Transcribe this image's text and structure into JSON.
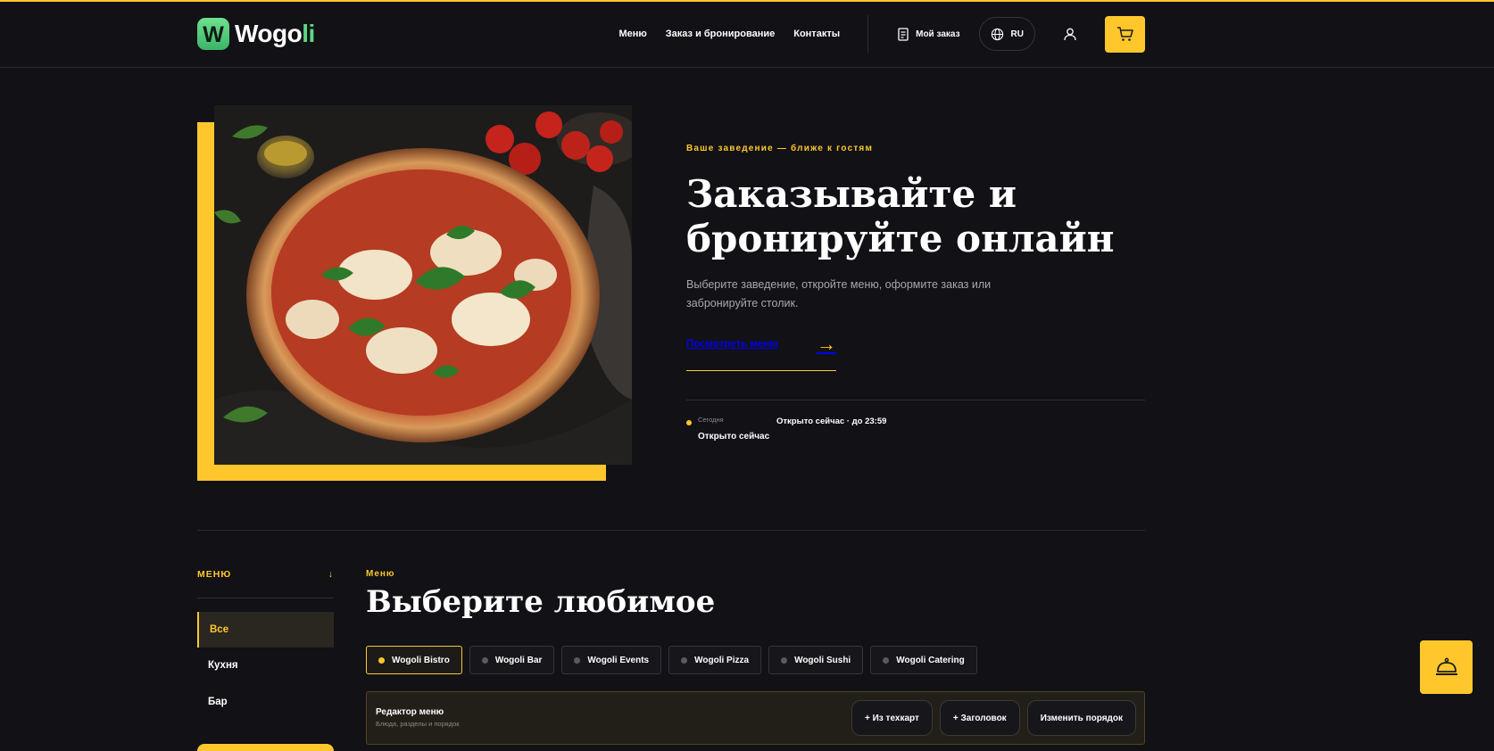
{
  "brand": {
    "logo_letter": "W",
    "name_part1": "Wogo",
    "name_part2": "li"
  },
  "nav": {
    "menu": "Меню",
    "booking": "Заказ и бронирование",
    "contacts": "Контакты"
  },
  "header": {
    "my_order": "Мой заказ",
    "language": "RU"
  },
  "hero": {
    "eyebrow": "Ваше заведение — ближе к гостям",
    "title_line1": "Заказывайте и",
    "title_line2": "бронируйте онлайн",
    "description": "Выберите заведение, откройте меню, оформите заказ или забронируйте столик.",
    "cta_label": "Посмотреть меню",
    "cta_arrow": "→",
    "status_day": "Сегодня",
    "status_main": "Открыто сейчас",
    "status_hours": "Открыто сейчас · до 23:59"
  },
  "sidebar": {
    "title": "МЕНЮ",
    "arrow": "↓",
    "items": [
      {
        "label": "Все"
      },
      {
        "label": "Кухня"
      },
      {
        "label": "Бар"
      }
    ]
  },
  "menu": {
    "eyebrow": "Меню",
    "title": "Выберите любимое",
    "venues": [
      {
        "label": "Wogoli Bistro"
      },
      {
        "label": "Wogoli Bar"
      },
      {
        "label": "Wogoli Events"
      },
      {
        "label": "Wogoli Pizza"
      },
      {
        "label": "Wogoli Sushi"
      },
      {
        "label": "Wogoli Catering"
      }
    ],
    "editor": {
      "title": "Редактор меню",
      "subtitle": "Блюда, разделы и порядок",
      "from_techcard": "+ Из техкарт",
      "add_heading": "+ Заголовок",
      "change_order": "Изменить порядок"
    }
  },
  "colors": {
    "accent": "#ffc72c",
    "background": "#111116",
    "brand_green": "#5fd684"
  },
  "icons": {
    "my_order": "receipt-icon",
    "language": "globe-icon",
    "user": "user-icon",
    "cart": "cart-icon",
    "service_bell": "service-bell-icon"
  }
}
